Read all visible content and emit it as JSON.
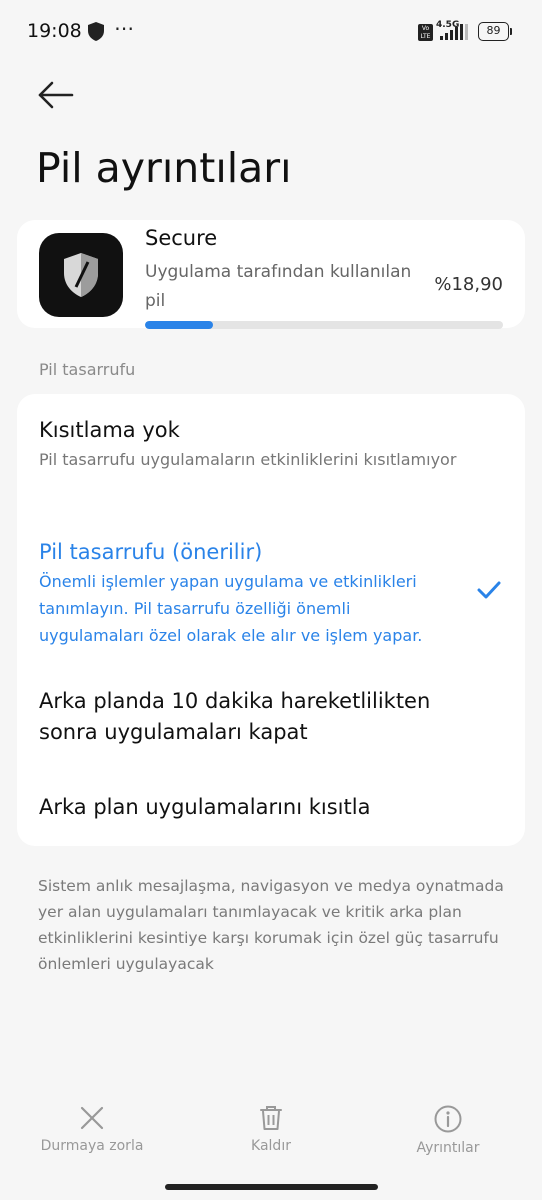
{
  "status_bar": {
    "time": "19:08",
    "dots": "⋯",
    "volte": "Vo LTE",
    "network": "4.5G",
    "battery": "89"
  },
  "page": {
    "title": "Pil ayrıntıları"
  },
  "app": {
    "name": "Secure",
    "usage_label": "Uygulama tarafından kullanılan pil",
    "usage_value": "%18,90",
    "usage_fraction": 0.189
  },
  "section": {
    "label": "Pil tasarrufu"
  },
  "options": [
    {
      "title": "Kısıtlama yok",
      "description": "Pil tasarrufu uygulamaların etkinliklerini kısıtlamıyor"
    },
    {
      "title": "Pil tasarrufu (önerilir)",
      "description": "Önemli işlemler yapan uygulama ve etkinlikleri tanımlayın. Pil tasarrufu özelliği önemli uygulamaları özel olarak ele alır ve işlem yapar.",
      "selected": true
    },
    {
      "title": "Arka planda 10 dakika hareketlilikten sonra uygulamaları kapat"
    },
    {
      "title": "Arka plan uygulamalarını kısıtla"
    }
  ],
  "footer_note": "Sistem anlık mesajlaşma, navigasyon ve medya oynatmada yer alan uygulamaları tanımlayacak ve kritik arka plan etkinliklerini kesintiye karşı korumak için özel güç tasarrufu önlemleri uygulayacak",
  "actions": {
    "force_stop": "Durmaya zorla",
    "uninstall": "Kaldır",
    "details": "Ayrıntılar"
  },
  "colors": {
    "accent": "#2a83e8",
    "background": "#f6f6f6",
    "card": "#ffffff"
  }
}
